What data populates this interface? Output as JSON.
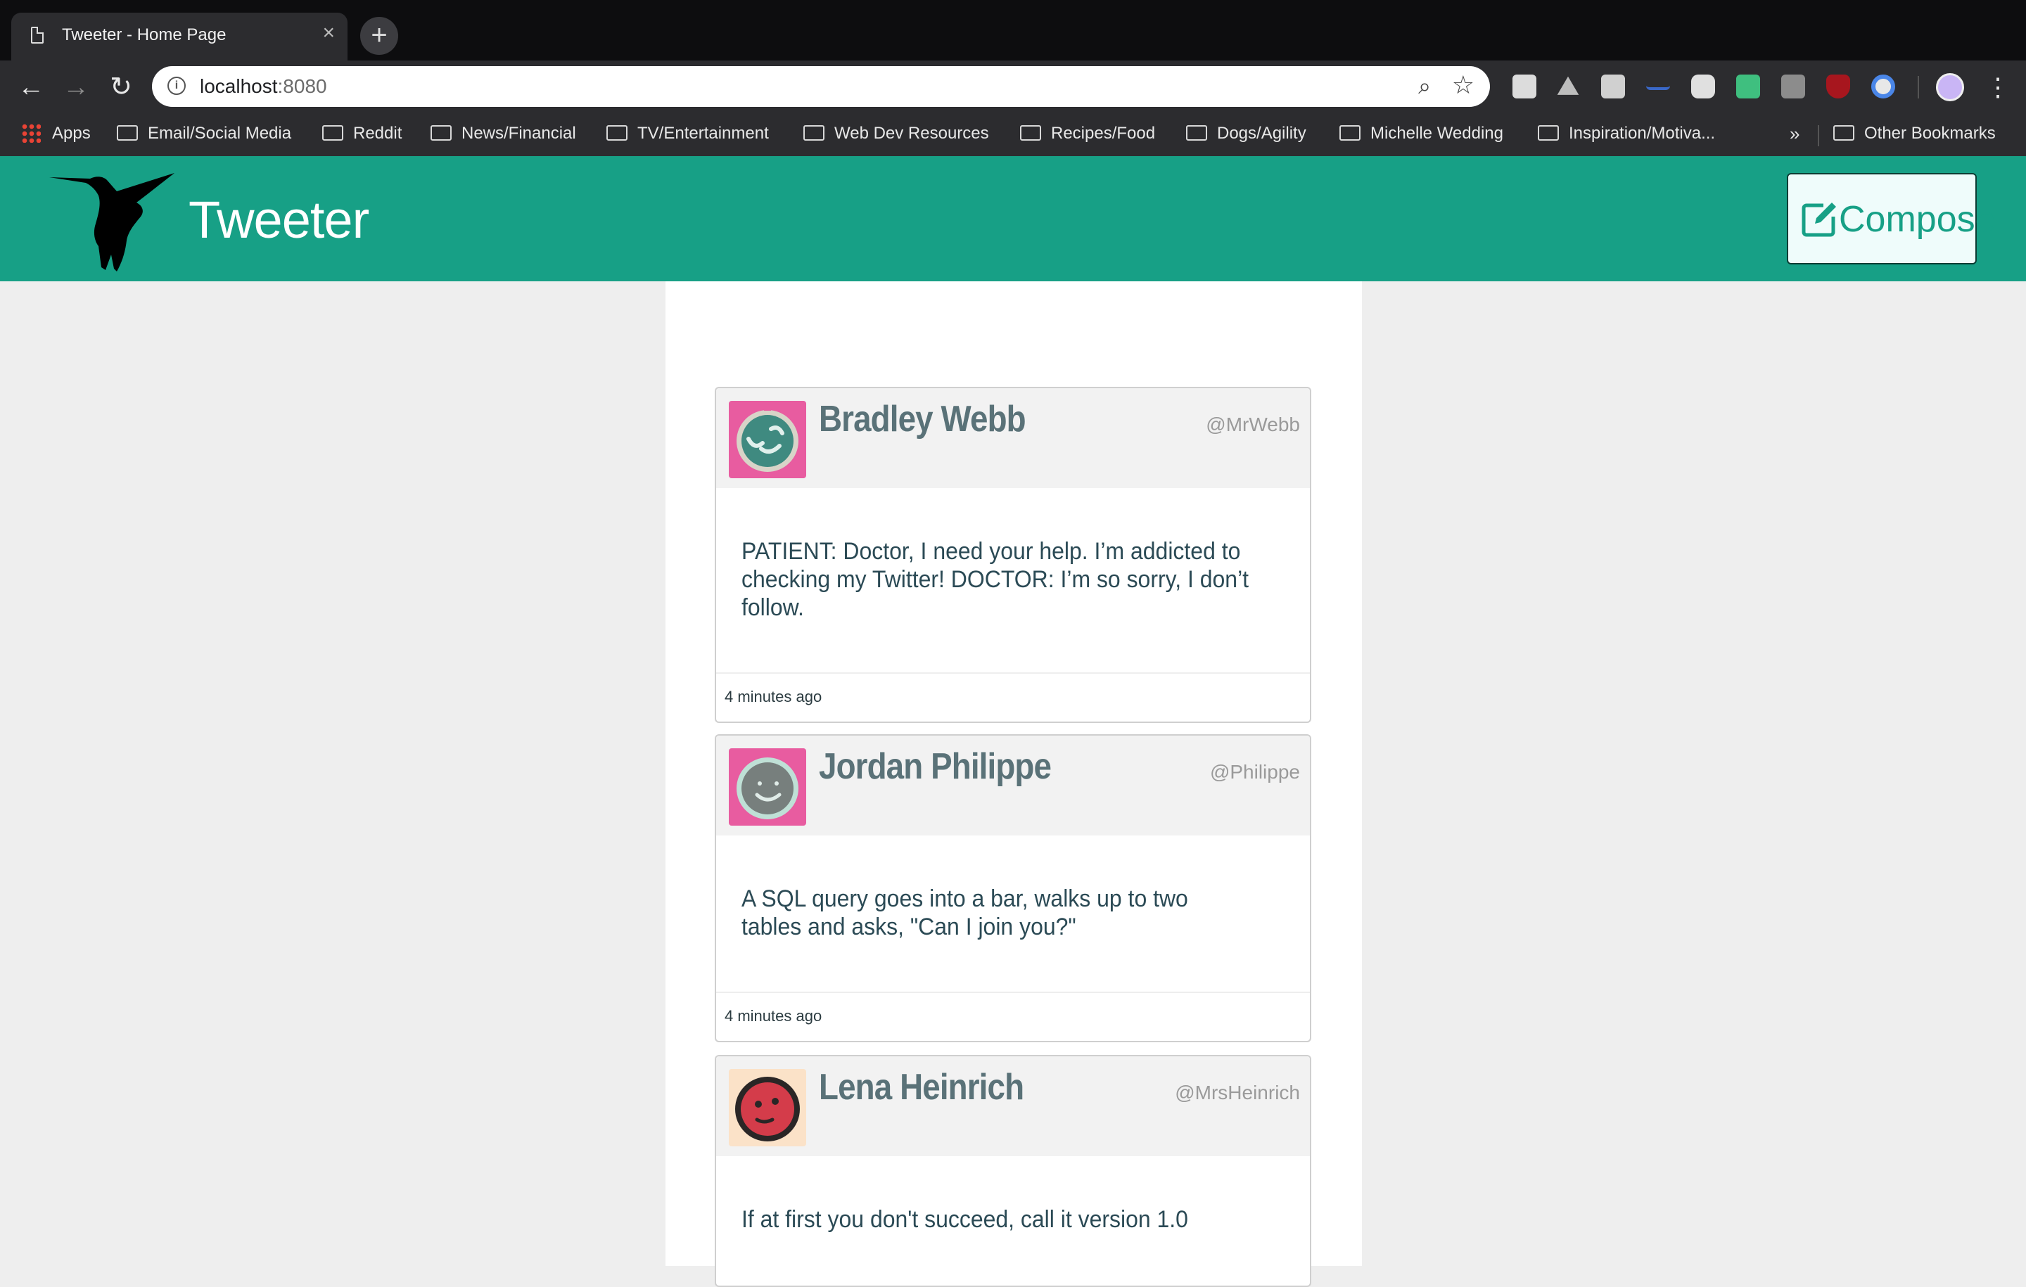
{
  "browser": {
    "tab_title": "Tweeter - Home Page",
    "tab_close": "×",
    "new_tab": "+",
    "url_host": "localhost",
    "url_port": ":8080",
    "bookmarks": [
      "Apps",
      "Email/Social Media",
      "Reddit",
      "News/Financial",
      "TV/Entertainment",
      "Web Dev Resources",
      "Recipes/Food",
      "Dogs/Agility",
      "Michelle Wedding",
      "Inspiration/Motiva...",
      "Other Bookmarks"
    ],
    "more": "»"
  },
  "header": {
    "brand": "Tweeter",
    "compose_label": "Compose",
    "brand_color": "#17a086"
  },
  "tweets": [
    {
      "name": "Bradley Webb",
      "handle": "@MrWebb",
      "text": "PATIENT: Doctor, I need your help. I’m addicted to checking my Twitter!  DOCTOR: I’m so sorry, I don’t follow.",
      "time": "4 minutes ago",
      "avatar_color": "#e85ca0"
    },
    {
      "name": "Jordan Philippe",
      "handle": "@Philippe",
      "text": "A SQL query goes into a bar, walks up to two tables and asks, \"Can I join you?\"",
      "time": "4 minutes ago",
      "avatar_color": "#e85ca0"
    },
    {
      "name": "Lena Heinrich",
      "handle": "@MrsHeinrich",
      "text": "If at first you don't succeed, call it version 1.0",
      "time": "",
      "avatar_color": "#fbe2c8"
    }
  ]
}
